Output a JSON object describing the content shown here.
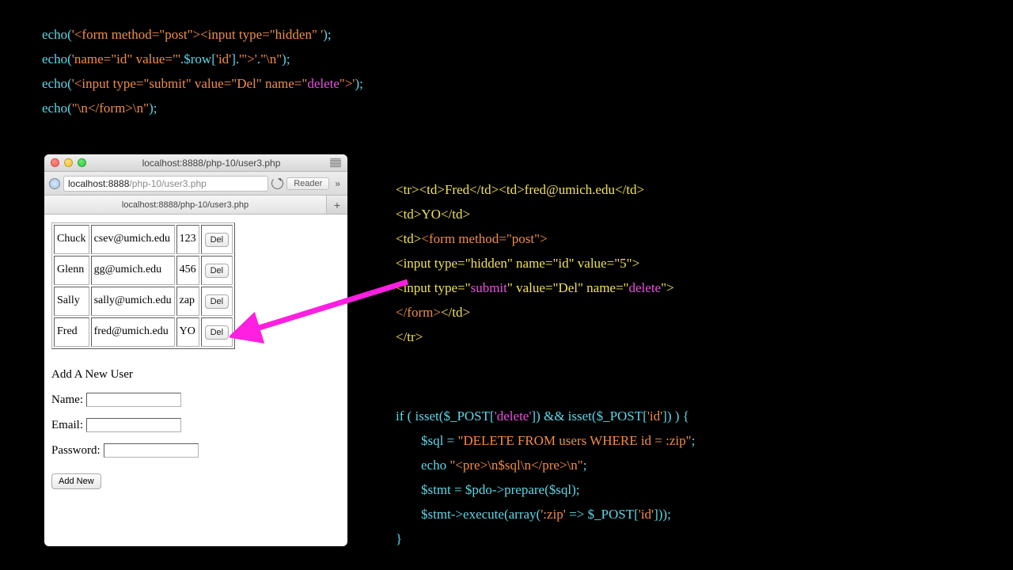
{
  "code_top": {
    "l1": {
      "a": "echo(",
      "b": "'<form method=\"post\"><input type=\"hidden\" '",
      "c": ");"
    },
    "l2": {
      "a": "echo(",
      "b": "'name=\"id\" value=\"'",
      "c": ".",
      "d": "$row",
      "e": "[",
      "f": "'id'",
      "g": "].",
      "h": "'\">'",
      "i": ".",
      "j": "\"\\n\"",
      "k": ");"
    },
    "l3": {
      "a": "echo(",
      "b": "'<input type=\"submit\" value=\"Del\" name=\"",
      "c": "delete",
      "d": "\">'",
      "e": ");"
    },
    "l4": {
      "a": "echo(",
      "b": "\"\\n",
      "c": "</form>",
      "d": "\\n\"",
      "e": ");"
    }
  },
  "browser": {
    "title": "localhost:8888/php-10/user3.php",
    "url_host": "localhost:8888",
    "url_path": "/php-10/user3.php",
    "reader": "Reader",
    "tab_label": "localhost:8888/php-10/user3.php",
    "tab_plus": "+",
    "del_label": "Del",
    "users": [
      {
        "name": "Chuck",
        "email": "csev@umich.edu",
        "pw": "123"
      },
      {
        "name": "Glenn",
        "email": "gg@umich.edu",
        "pw": "456"
      },
      {
        "name": "Sally",
        "email": "sally@umich.edu",
        "pw": "zap"
      },
      {
        "name": "Fred",
        "email": "fred@umich.edu",
        "pw": "YO"
      }
    ],
    "add_heading": "Add A New User",
    "form": {
      "name_label": "Name:",
      "email_label": "Email:",
      "password_label": "Password:",
      "submit_label": "Add New"
    }
  },
  "html_right": {
    "l1": {
      "a": "<tr><td>",
      "b": "Fred",
      "c": "</td><td>",
      "d": "fred@umich.edu",
      "e": "</td>"
    },
    "l2": {
      "a": "<td>",
      "b": "YO",
      "c": "</td>"
    },
    "l3": {
      "a": "<td>",
      "b": "<form method=\"post\">"
    },
    "l4": "<input type=\"hidden\" name=\"id\" value=\"5\">",
    "l5": {
      "a": "<input type=\"",
      "b": "submit",
      "c": "\" value=\"",
      "d": "Del",
      "e": "\" name=\"",
      "f": "delete",
      "g": "\">"
    },
    "l6": {
      "a": "</form>",
      "b": "</td>"
    },
    "l7": "</tr>"
  },
  "php_bottom": {
    "l1": {
      "a": "if ( isset(",
      "b": "$_POST",
      "c": "[",
      "d": "'delete'",
      "e": "]) && isset(",
      "f": "$_POST",
      "g": "[",
      "h": "'id'",
      "i": "]) ) {"
    },
    "l2": {
      "a": "$sql",
      "b": " = ",
      "c": "\"DELETE FROM users WHERE id = :zip\"",
      "d": ";"
    },
    "l3": {
      "a": "echo ",
      "b": "\"<pre>\\n$sql\\n</pre>\\n\"",
      "c": ";"
    },
    "l4": {
      "a": "$stmt",
      "b": " = ",
      "c": "$pdo",
      "d": "->prepare(",
      "e": "$sql",
      "f": ");"
    },
    "l5": {
      "a": "$stmt",
      "b": "->execute(array(",
      "c": "':zip'",
      "d": " => ",
      "e": "$_POST",
      "f": "[",
      "g": "'id'",
      "h": "]));"
    },
    "l6": "}"
  }
}
